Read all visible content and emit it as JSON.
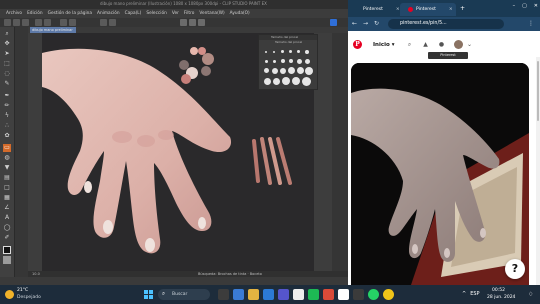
{
  "csp": {
    "title": "dibujo mano preliminar (Ilustración) 1080 x 1080px 300dpi - CLIP STUDIO PAINT EX",
    "menu": [
      "Archivo",
      "Edición",
      "Gestión de la página",
      "Animación",
      "Capa(L)",
      "Selección",
      "Ver",
      "Filtro",
      "Ventana(W)",
      "Ayuda(O)"
    ],
    "doc_tab": "dibujo mano preliminar",
    "status_left": "10.0",
    "status_right": "Búsqueda: Brochas de tinta · Boceto",
    "color_panel_title": "Tamaño del pincel",
    "color_panel_sub": "Tamaño del pincel",
    "palette_colors": [
      "#e7b7ad",
      "#d38e88",
      "#b28c84",
      "#7f6e6c",
      "#e6d2cd",
      "#c77f7a",
      "#8c7673"
    ],
    "stroke_colors": [
      "#b8776e",
      "#c08479",
      "#d09a8d",
      "#bb7c72"
    ]
  },
  "browser": {
    "tabs": [
      {
        "label": "Pinterest"
      },
      {
        "label": "Pinterest"
      }
    ],
    "url": "pinterest.es/pin/5...",
    "home_label": "Inicio",
    "tooltip": "Pinterest",
    "help_label": "?"
  },
  "taskbar": {
    "temperature": "21°C",
    "condition": "Despejado",
    "search_label": "Buscar",
    "time": "00:52",
    "date": "28 jun. 2024",
    "language": "ESP"
  },
  "icons": {
    "browser_menu": "three-dots-icon",
    "help": "question-mark-icon"
  }
}
